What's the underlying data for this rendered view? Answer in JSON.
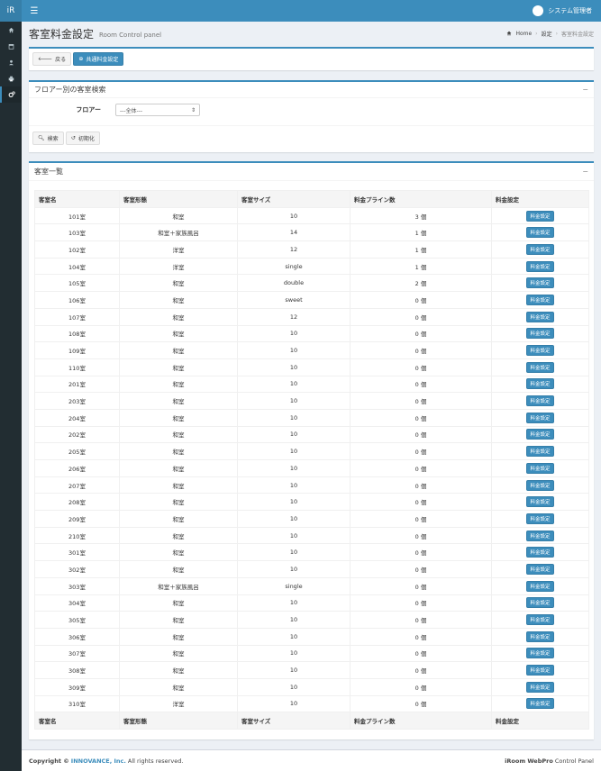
{
  "header": {
    "logo": "iR",
    "user_name": "システム管理者"
  },
  "sidebar": {
    "icons": [
      "home-icon",
      "calendar-icon",
      "user-icon",
      "print-icon",
      "gears-icon"
    ]
  },
  "page": {
    "title": "客室料金設定",
    "subtitle": "Room Control panel"
  },
  "breadcrumb": {
    "home": "Home",
    "settings": "設定",
    "current": "客室料金設定"
  },
  "toolbar": {
    "back_label": "戻る",
    "common_fee_label": "共通料金設定"
  },
  "search": {
    "title": "フロアー別の客室検索",
    "floor_label": "フロアー",
    "floor_value": "---全体---",
    "search_label": "検索",
    "reset_label": "初期化"
  },
  "list": {
    "title": "客室一覧",
    "columns": [
      "客室名",
      "客室形態",
      "客室サイズ",
      "料金プライン数",
      "料金設定"
    ],
    "fee_button_label": "料金設定",
    "rows": [
      [
        "101室",
        "和室",
        "10",
        "3 個"
      ],
      [
        "103室",
        "和室＋家族風呂",
        "14",
        "1 個"
      ],
      [
        "102室",
        "洋室",
        "12",
        "1 個"
      ],
      [
        "104室",
        "洋室",
        "single",
        "1 個"
      ],
      [
        "105室",
        "和室",
        "double",
        "2 個"
      ],
      [
        "106室",
        "和室",
        "sweet",
        "0 個"
      ],
      [
        "107室",
        "和室",
        "12",
        "0 個"
      ],
      [
        "108室",
        "和室",
        "10",
        "0 個"
      ],
      [
        "109室",
        "和室",
        "10",
        "0 個"
      ],
      [
        "110室",
        "和室",
        "10",
        "0 個"
      ],
      [
        "201室",
        "和室",
        "10",
        "0 個"
      ],
      [
        "203室",
        "和室",
        "10",
        "0 個"
      ],
      [
        "204室",
        "和室",
        "10",
        "0 個"
      ],
      [
        "202室",
        "和室",
        "10",
        "0 個"
      ],
      [
        "205室",
        "和室",
        "10",
        "0 個"
      ],
      [
        "206室",
        "和室",
        "10",
        "0 個"
      ],
      [
        "207室",
        "和室",
        "10",
        "0 個"
      ],
      [
        "208室",
        "和室",
        "10",
        "0 個"
      ],
      [
        "209室",
        "和室",
        "10",
        "0 個"
      ],
      [
        "210室",
        "和室",
        "10",
        "0 個"
      ],
      [
        "301室",
        "和室",
        "10",
        "0 個"
      ],
      [
        "302室",
        "和室",
        "10",
        "0 個"
      ],
      [
        "303室",
        "和室＋家族風呂",
        "single",
        "0 個"
      ],
      [
        "304室",
        "和室",
        "10",
        "0 個"
      ],
      [
        "305室",
        "和室",
        "10",
        "0 個"
      ],
      [
        "306室",
        "和室",
        "10",
        "0 個"
      ],
      [
        "307室",
        "和室",
        "10",
        "0 個"
      ],
      [
        "308室",
        "和室",
        "10",
        "0 個"
      ],
      [
        "309室",
        "和室",
        "10",
        "0 個"
      ],
      [
        "310室",
        "洋室",
        "10",
        "0 個"
      ]
    ]
  },
  "footer": {
    "copyright_prefix": "Copyright ©",
    "company": "INNOVANCE, Inc.",
    "rights": "All rights reserved.",
    "product_bold": "iRoom WebPro",
    "product_rest": "Control Panel"
  },
  "colors": {
    "accent": "#3c8dbc",
    "sidebar": "#222d32"
  }
}
